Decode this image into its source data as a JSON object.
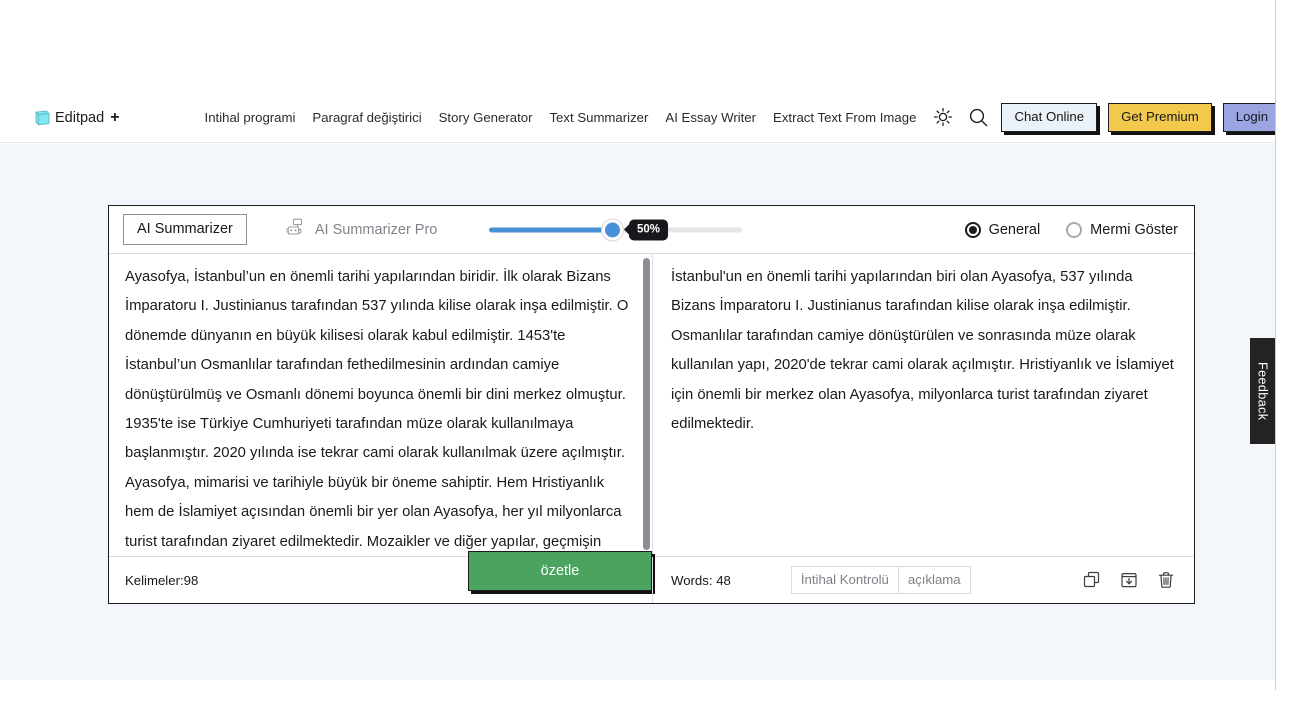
{
  "header": {
    "brand": {
      "icon": "notepad-icon",
      "name": "Editpad",
      "plus": "+"
    },
    "nav": [
      {
        "label": "Intihal programi"
      },
      {
        "label": "Paragraf değiştirici"
      },
      {
        "label": "Story Generator"
      },
      {
        "label": "Text Summarizer"
      },
      {
        "label": "AI Essay Writer"
      },
      {
        "label": "Extract Text From Image"
      }
    ],
    "icons": [
      {
        "name": "theme-sun-icon"
      },
      {
        "name": "search-icon"
      }
    ],
    "buttons": {
      "chat_online": "Chat Online",
      "get_premium": "Get Premium",
      "login": "Login"
    }
  },
  "toolbar": {
    "tab_active": "AI Summarizer",
    "tab_pro": "AI Summarizer Pro",
    "tab_pro_icon": "robot-icon",
    "slider": {
      "value": 50,
      "badge": "50%",
      "min": 0,
      "max": 100
    },
    "modes": [
      {
        "label": "General",
        "selected": true
      },
      {
        "label": "Mermi Göster",
        "selected": false
      }
    ]
  },
  "editor": {
    "input_text": "Ayasofya, İstanbul’un en önemli tarihi yapılarından biridir. İlk olarak Bizans İmparatoru I. Justinianus tarafından 537 yılında kilise olarak inşa edilmiştir. O dönemde dünyanın en büyük kilisesi olarak kabul edilmiştir. 1453'te İstanbul’un Osmanlılar tarafından fethedilmesinin ardından camiye dönüştürülmüş ve Osmanlı dönemi boyunca önemli bir dini merkez olmuştur. 1935'te ise Türkiye Cumhuriyeti tarafından müze olarak kullanılmaya başlanmıştır. 2020 yılında ise tekrar cami olarak kullanılmak üzere açılmıştır. Ayasofya, mimarisi ve tarihiyle büyük bir öneme sahiptir. Hem Hristiyanlık hem de İslamiyet açısından önemli bir yer olan Ayasofya, her yıl milyonlarca turist tarafından ziyaret edilmektedir. Mozaikler ve diğer yapılar, geçmişin izlerini",
    "output_text": "İstanbul'un en önemli tarihi yapılarından biri olan Ayasofya, 537 yılında Bizans İmparatoru I. Justinianus tarafından kilise olarak inşa edilmiştir. Osmanlılar tarafından camiye dönüştürülen ve sonrasında müze olarak kullanılan yapı, 2020'de tekrar cami olarak açılmıştır. Hristiyanlık ve İslamiyet için önemli bir merkez olan Ayasofya, milyonlarca turist tarafından ziyaret edilmektedir."
  },
  "footer": {
    "left_count": "Kelimeler:98",
    "summarize_button": "özetle",
    "right_count": "Words: 48",
    "plagiarism_button": "İntihal Kontrolü",
    "explain_button": "açıklama",
    "icons": [
      {
        "name": "copy-icon"
      },
      {
        "name": "download-icon"
      },
      {
        "name": "trash-icon"
      }
    ]
  },
  "feedback": {
    "label": "Feedback"
  },
  "colors": {
    "page_background": "#f3f6fb",
    "accent_blue": "#4a90d9",
    "summarize_green": "#4aa35f",
    "premium_yellow": "#f2c94c",
    "login_purple": "#9aa4e0",
    "chat_blue": "#eaf1f7",
    "badge_dark": "#16181c"
  }
}
